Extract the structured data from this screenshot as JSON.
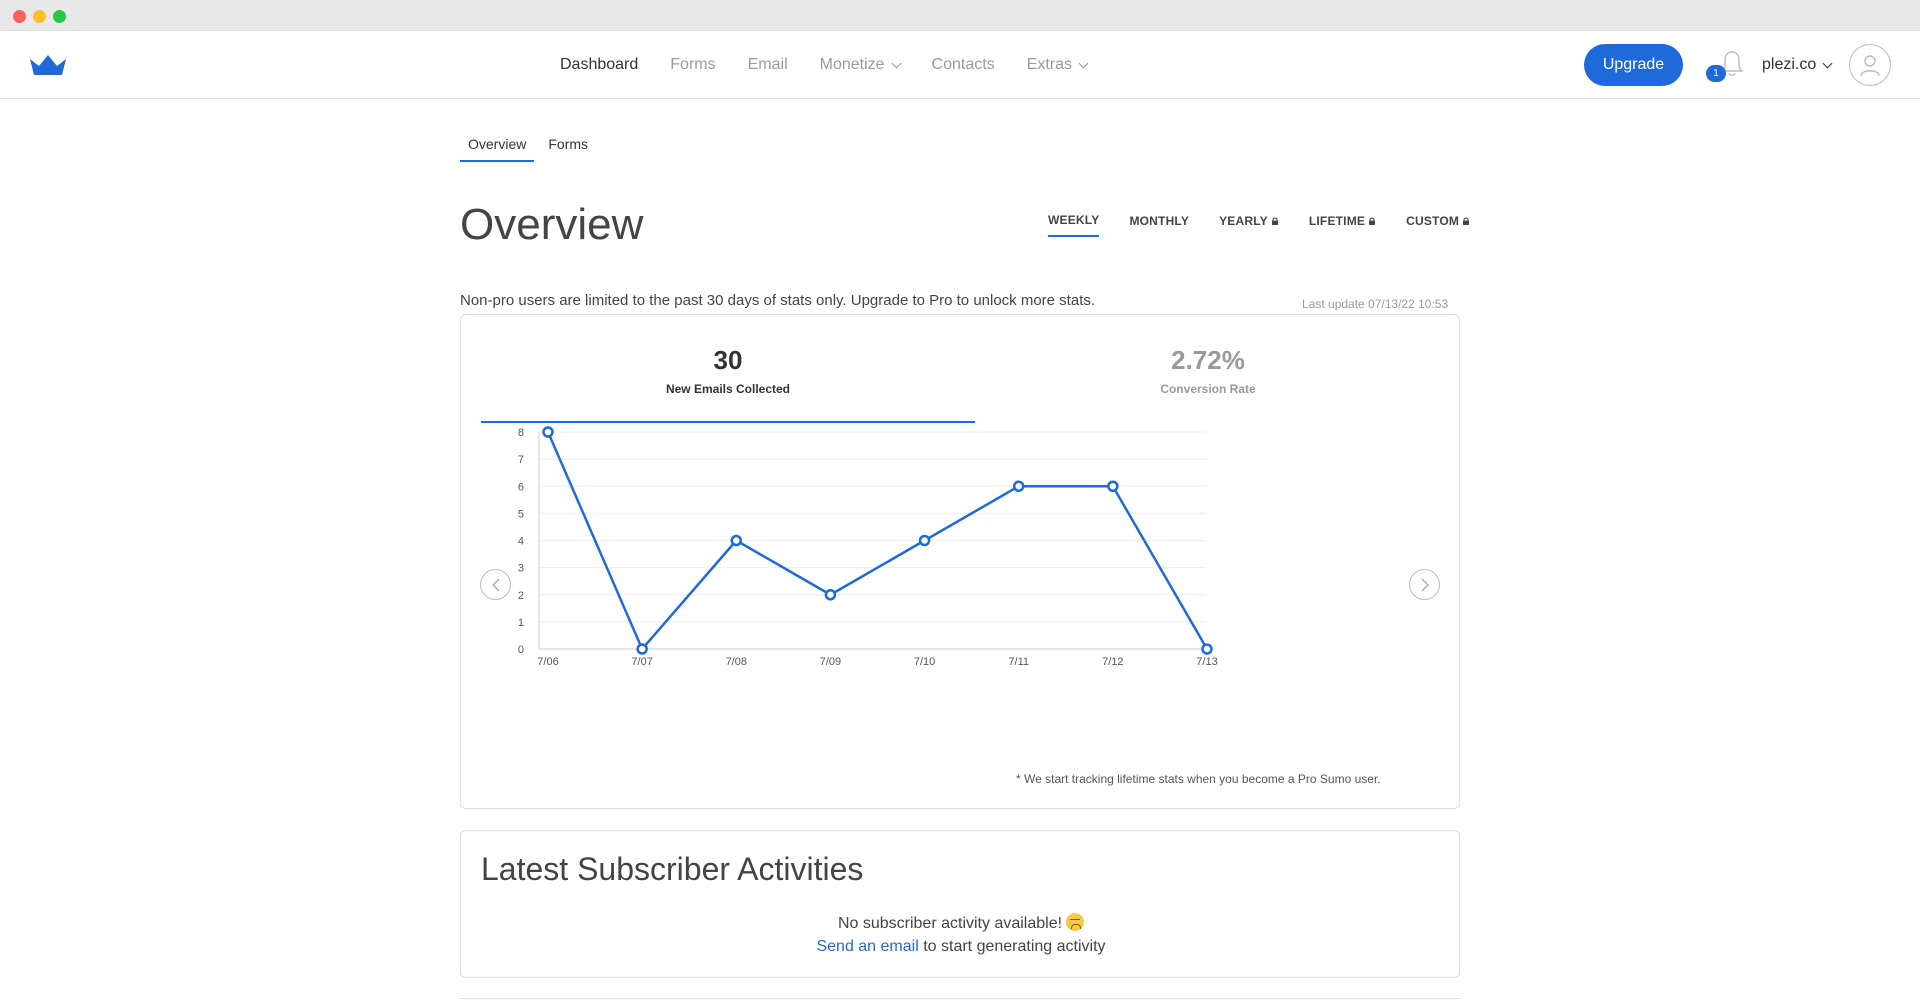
{
  "nav": {
    "items": [
      {
        "label": "Dashboard",
        "active": true,
        "dropdown": false
      },
      {
        "label": "Forms",
        "active": false,
        "dropdown": false
      },
      {
        "label": "Email",
        "active": false,
        "dropdown": false
      },
      {
        "label": "Monetize",
        "active": false,
        "dropdown": true
      },
      {
        "label": "Contacts",
        "active": false,
        "dropdown": false
      },
      {
        "label": "Extras",
        "active": false,
        "dropdown": true
      }
    ],
    "upgrade_label": "Upgrade",
    "notification_count": "1",
    "account_label": "plezi.co",
    "brand_color": "#1f6ad9",
    "logo_icon": "crown-icon"
  },
  "subtabs": [
    {
      "label": "Overview",
      "active": true
    },
    {
      "label": "Forms",
      "active": false
    }
  ],
  "page_title": "Overview",
  "range_tabs": [
    {
      "label": "WEEKLY",
      "active": true,
      "locked": false
    },
    {
      "label": "MONTHLY",
      "active": false,
      "locked": false
    },
    {
      "label": "YEARLY",
      "active": false,
      "locked": true
    },
    {
      "label": "LIFETIME",
      "active": false,
      "locked": true
    },
    {
      "label": "CUSTOM",
      "active": false,
      "locked": true
    }
  ],
  "notice": "Non-pro users are limited to the past 30 days of stats only.  Upgrade to Pro to unlock more stats.",
  "last_update": "Last update 07/13/22 10:53",
  "stats": {
    "emails": {
      "value": "30",
      "label": "New Emails Collected"
    },
    "conversion": {
      "value": "2.72%",
      "label": "Conversion Rate"
    }
  },
  "chart_data": {
    "type": "line",
    "x": [
      "7/06",
      "7/07",
      "7/08",
      "7/09",
      "7/10",
      "7/11",
      "7/12",
      "7/13"
    ],
    "series": [
      {
        "values": [
          8,
          0,
          4,
          2,
          4,
          6,
          6,
          0
        ]
      }
    ],
    "yticks": [
      "0",
      "1",
      "2",
      "3",
      "4",
      "5",
      "6",
      "7",
      "8"
    ],
    "ylim": [
      0,
      8
    ],
    "grid": true,
    "line_color": "#1f6ad9"
  },
  "footnote": "* We start tracking lifetime stats when you become a Pro Sumo user.",
  "activities": {
    "title": "Latest Subscriber Activities",
    "empty_text": "No subscriber activity available!",
    "emoji_icon": "disappointed-face-icon",
    "cta_link": "Send an email",
    "cta_rest": "to start generating activity"
  }
}
